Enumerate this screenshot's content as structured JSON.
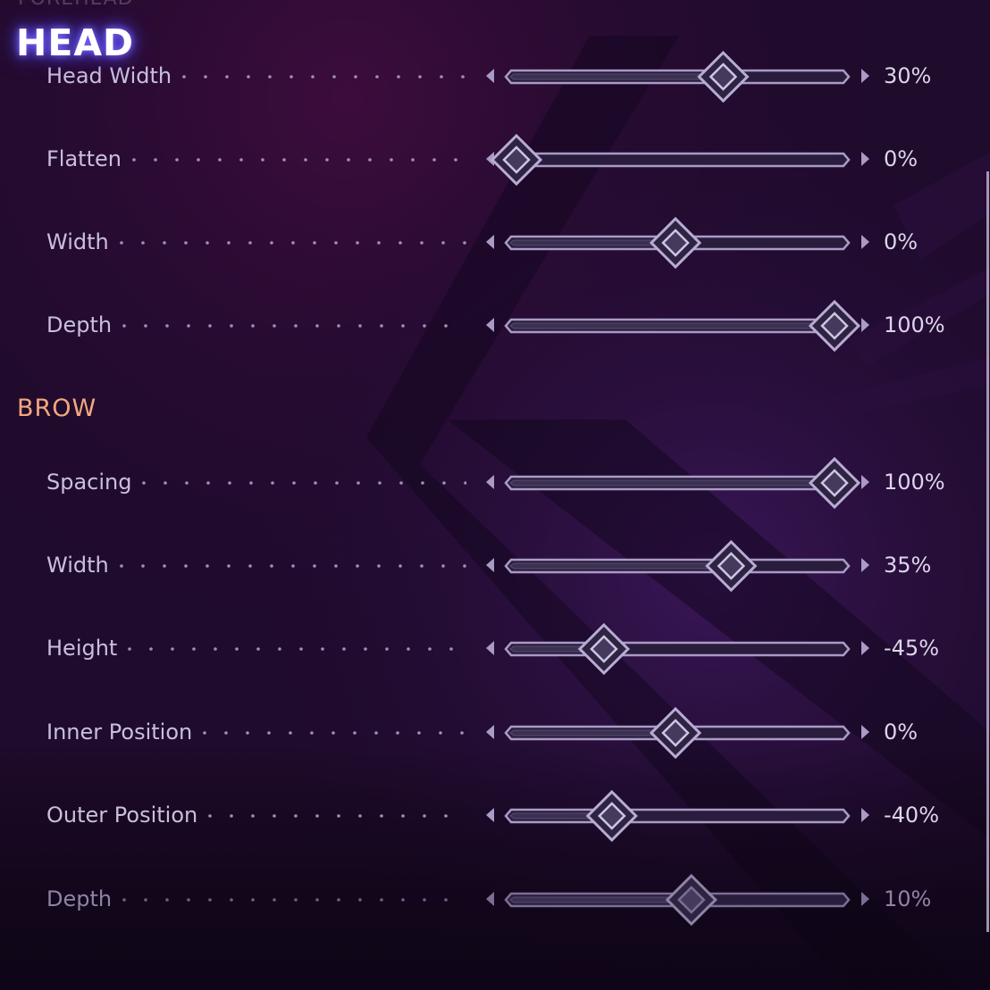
{
  "colors": {
    "section_title": "#ffffff",
    "section_glow": "#6a5cff",
    "subsection_title": "#f2a87d",
    "label": "#c9bfdc",
    "slider_track": "#a99bc6",
    "slider_fill": "#3a3050",
    "background": "#1c0a2a"
  },
  "top_cut_label": "FOREHEAD",
  "sections": [
    {
      "title": "HEAD",
      "style": "glow",
      "rows": [
        {
          "label": "Head Width",
          "value_text": "30%",
          "value": 30,
          "min": -100,
          "max": 100,
          "dim": false
        },
        {
          "label": "Flatten",
          "value_text": "0%",
          "value": 0,
          "min": 0,
          "max": 100,
          "dim": false
        },
        {
          "label": "Width",
          "value_text": "0%",
          "value": 0,
          "min": -100,
          "max": 100,
          "dim": false
        },
        {
          "label": "Depth",
          "value_text": "100%",
          "value": 100,
          "min": -100,
          "max": 100,
          "dim": false
        }
      ]
    },
    {
      "title": "BROW",
      "style": "orange",
      "rows": [
        {
          "label": "Spacing",
          "value_text": "100%",
          "value": 100,
          "min": -100,
          "max": 100,
          "dim": false
        },
        {
          "label": "Width",
          "value_text": "35%",
          "value": 35,
          "min": -100,
          "max": 100,
          "dim": false
        },
        {
          "label": "Height",
          "value_text": "-45%",
          "value": -45,
          "min": -100,
          "max": 100,
          "dim": false
        },
        {
          "label": "Inner Position",
          "value_text": "0%",
          "value": 0,
          "min": -100,
          "max": 100,
          "dim": false
        },
        {
          "label": "Outer Position",
          "value_text": "-40%",
          "value": -40,
          "min": -100,
          "max": 100,
          "dim": false
        },
        {
          "label": "Depth",
          "value_text": "10%",
          "value": 10,
          "min": -100,
          "max": 100,
          "dim": true
        }
      ]
    }
  ]
}
